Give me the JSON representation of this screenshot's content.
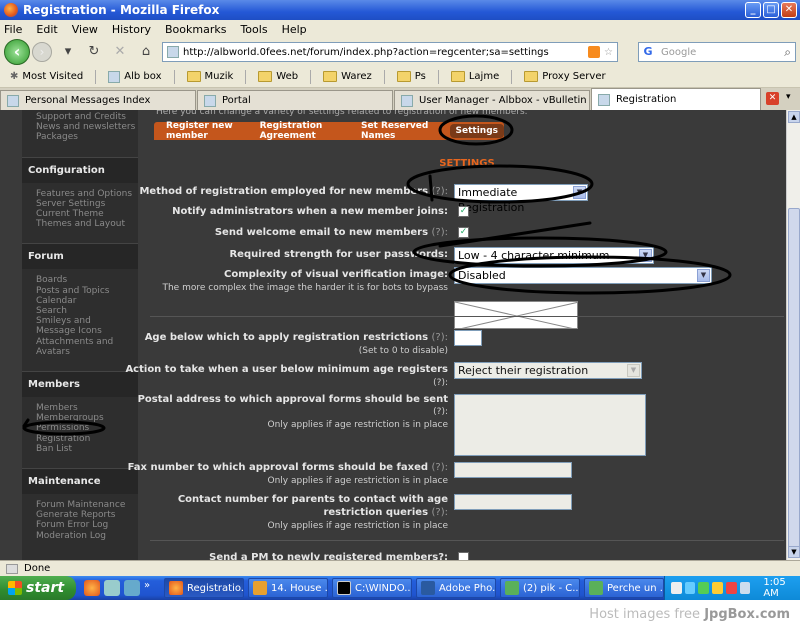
{
  "window": {
    "title": "Registration - Mozilla Firefox"
  },
  "menu": [
    "File",
    "Edit",
    "View",
    "History",
    "Bookmarks",
    "Tools",
    "Help"
  ],
  "address": {
    "url": "http://albworld.0fees.net/forum/index.php?action=regcenter;sa=settings"
  },
  "search": {
    "placeholder": "Google"
  },
  "bookmarks": [
    "Most Visited",
    "Alb box",
    "Muzik",
    "Web",
    "Warez",
    "Ps",
    "Lajme",
    "Proxy Server"
  ],
  "tabs": [
    "Personal Messages Index",
    "Portal",
    "User Manager - Albbox - vBulletin Panel...",
    "Registration"
  ],
  "sidebar": {
    "top_links": [
      "Support and Credits",
      "News and newsletters",
      "Packages"
    ],
    "groups": [
      {
        "title": "Configuration",
        "links": [
          "Features and Options",
          "Server Settings",
          "Current Theme",
          "Themes and Layout"
        ]
      },
      {
        "title": "Forum",
        "links": [
          "Boards",
          "Posts and Topics",
          "Calendar",
          "Search",
          "Smileys and Message Icons",
          "Attachments and Avatars"
        ]
      },
      {
        "title": "Members",
        "links": [
          "Members",
          "Membergroups",
          "Permissions",
          "Registration",
          "Ban List"
        ]
      },
      {
        "title": "Maintenance",
        "links": [
          "Forum Maintenance",
          "Generate Reports",
          "Forum Error Log",
          "Moderation Log"
        ]
      }
    ]
  },
  "main": {
    "intro": "Here you can change a variety of settings related to registration of new members.",
    "subtabs": [
      "Register new member",
      "Registration Agreement",
      "Set Reserved Names",
      "Settings"
    ],
    "section_title": "SETTINGS",
    "settings": {
      "method_label": "Method of registration employed for new members",
      "method_value": "Immediate Registration",
      "notify_label": "Notify administrators when a new member joins:",
      "welcome_label": "Send welcome email to new members",
      "strength_label": "Required strength for user passwords:",
      "strength_value": "Low - 4 character minimum",
      "captcha_label": "Complexity of visual verification image:",
      "captcha_sub": "The more complex the image the harder it is for bots to bypass",
      "captcha_value": "Disabled",
      "age_label": "Age below which to apply registration restrictions",
      "age_sub": "(Set to 0 to disable)",
      "action_label": "Action to take when a user below minimum age registers",
      "action_value": "Reject their registration",
      "postal_label": "Postal address to which approval forms should be sent",
      "fax_label": "Fax number to which approval forms should be faxed",
      "contact_label_1": "Contact number for parents to contact with age",
      "contact_label_2": "restriction queries",
      "applies_sub": "Only applies if age restriction is in place",
      "pm_label": "Send a PM to newly registered members?:",
      "help_mark": "(?)",
      "help_colon": "(?):"
    }
  },
  "status": {
    "text": "Done"
  },
  "taskbar": {
    "start": "start",
    "tasks": [
      "Registratio...",
      "14. House ...",
      "C:\\WINDO...",
      "Adobe Pho...",
      "(2) pik - C...",
      "Perche un ..."
    ],
    "clock": "1:05 AM"
  },
  "footer": {
    "prefix": "Host images free ",
    "brand": "JpgBox.com"
  },
  "colors": {
    "accent": "#c4561c",
    "section_title": "#e8661e",
    "page_bg": "#3a3a3a",
    "sidebar_bg": "#2e2e2e"
  }
}
